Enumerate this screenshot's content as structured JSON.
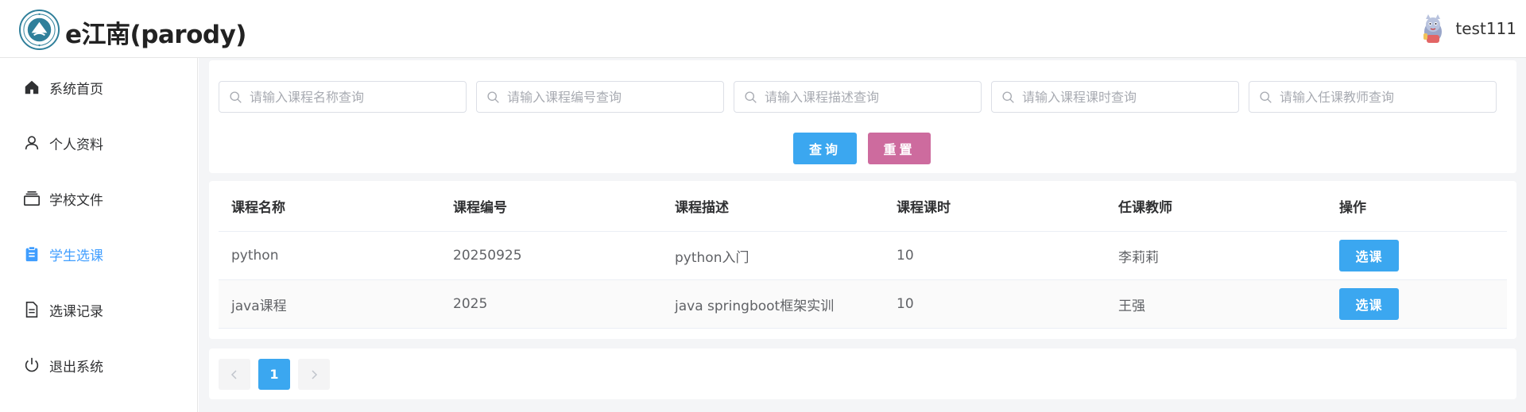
{
  "header": {
    "brand": "e江南(parody)",
    "username": "test111"
  },
  "sidebar": {
    "items": [
      {
        "label": "系统首页",
        "icon": "home-icon",
        "active": false
      },
      {
        "label": "个人资料",
        "icon": "user-icon",
        "active": false
      },
      {
        "label": "学校文件",
        "icon": "files-icon",
        "active": false
      },
      {
        "label": "学生选课",
        "icon": "clipboard-icon",
        "active": true
      },
      {
        "label": "选课记录",
        "icon": "document-icon",
        "active": false
      },
      {
        "label": "退出系统",
        "icon": "power-icon",
        "active": false
      }
    ]
  },
  "search": {
    "fields": [
      {
        "placeholder": "请输入课程名称查询",
        "value": ""
      },
      {
        "placeholder": "请输入课程编号查询",
        "value": ""
      },
      {
        "placeholder": "请输入课程描述查询",
        "value": ""
      },
      {
        "placeholder": "请输入课程课时查询",
        "value": ""
      },
      {
        "placeholder": "请输入任课教师查询",
        "value": ""
      }
    ],
    "query_label": "查询",
    "reset_label": "重置"
  },
  "table": {
    "headers": [
      "课程名称",
      "课程编号",
      "课程描述",
      "课程课时",
      "任课教师",
      "操作"
    ],
    "rows": [
      {
        "name": "python",
        "code": "20250925",
        "desc": "python入门",
        "hours": "10",
        "teacher": "李莉莉",
        "action": "选课"
      },
      {
        "name": "java课程",
        "code": "2025",
        "desc": "java springboot框架实训",
        "hours": "10",
        "teacher": "王强",
        "action": "选课"
      }
    ]
  },
  "pagination": {
    "current_page": "1"
  },
  "colors": {
    "primary": "#3ba7f0",
    "reset": "#cd6b9e",
    "active_nav": "#409eff",
    "content_bg": "#f4f5f7"
  }
}
